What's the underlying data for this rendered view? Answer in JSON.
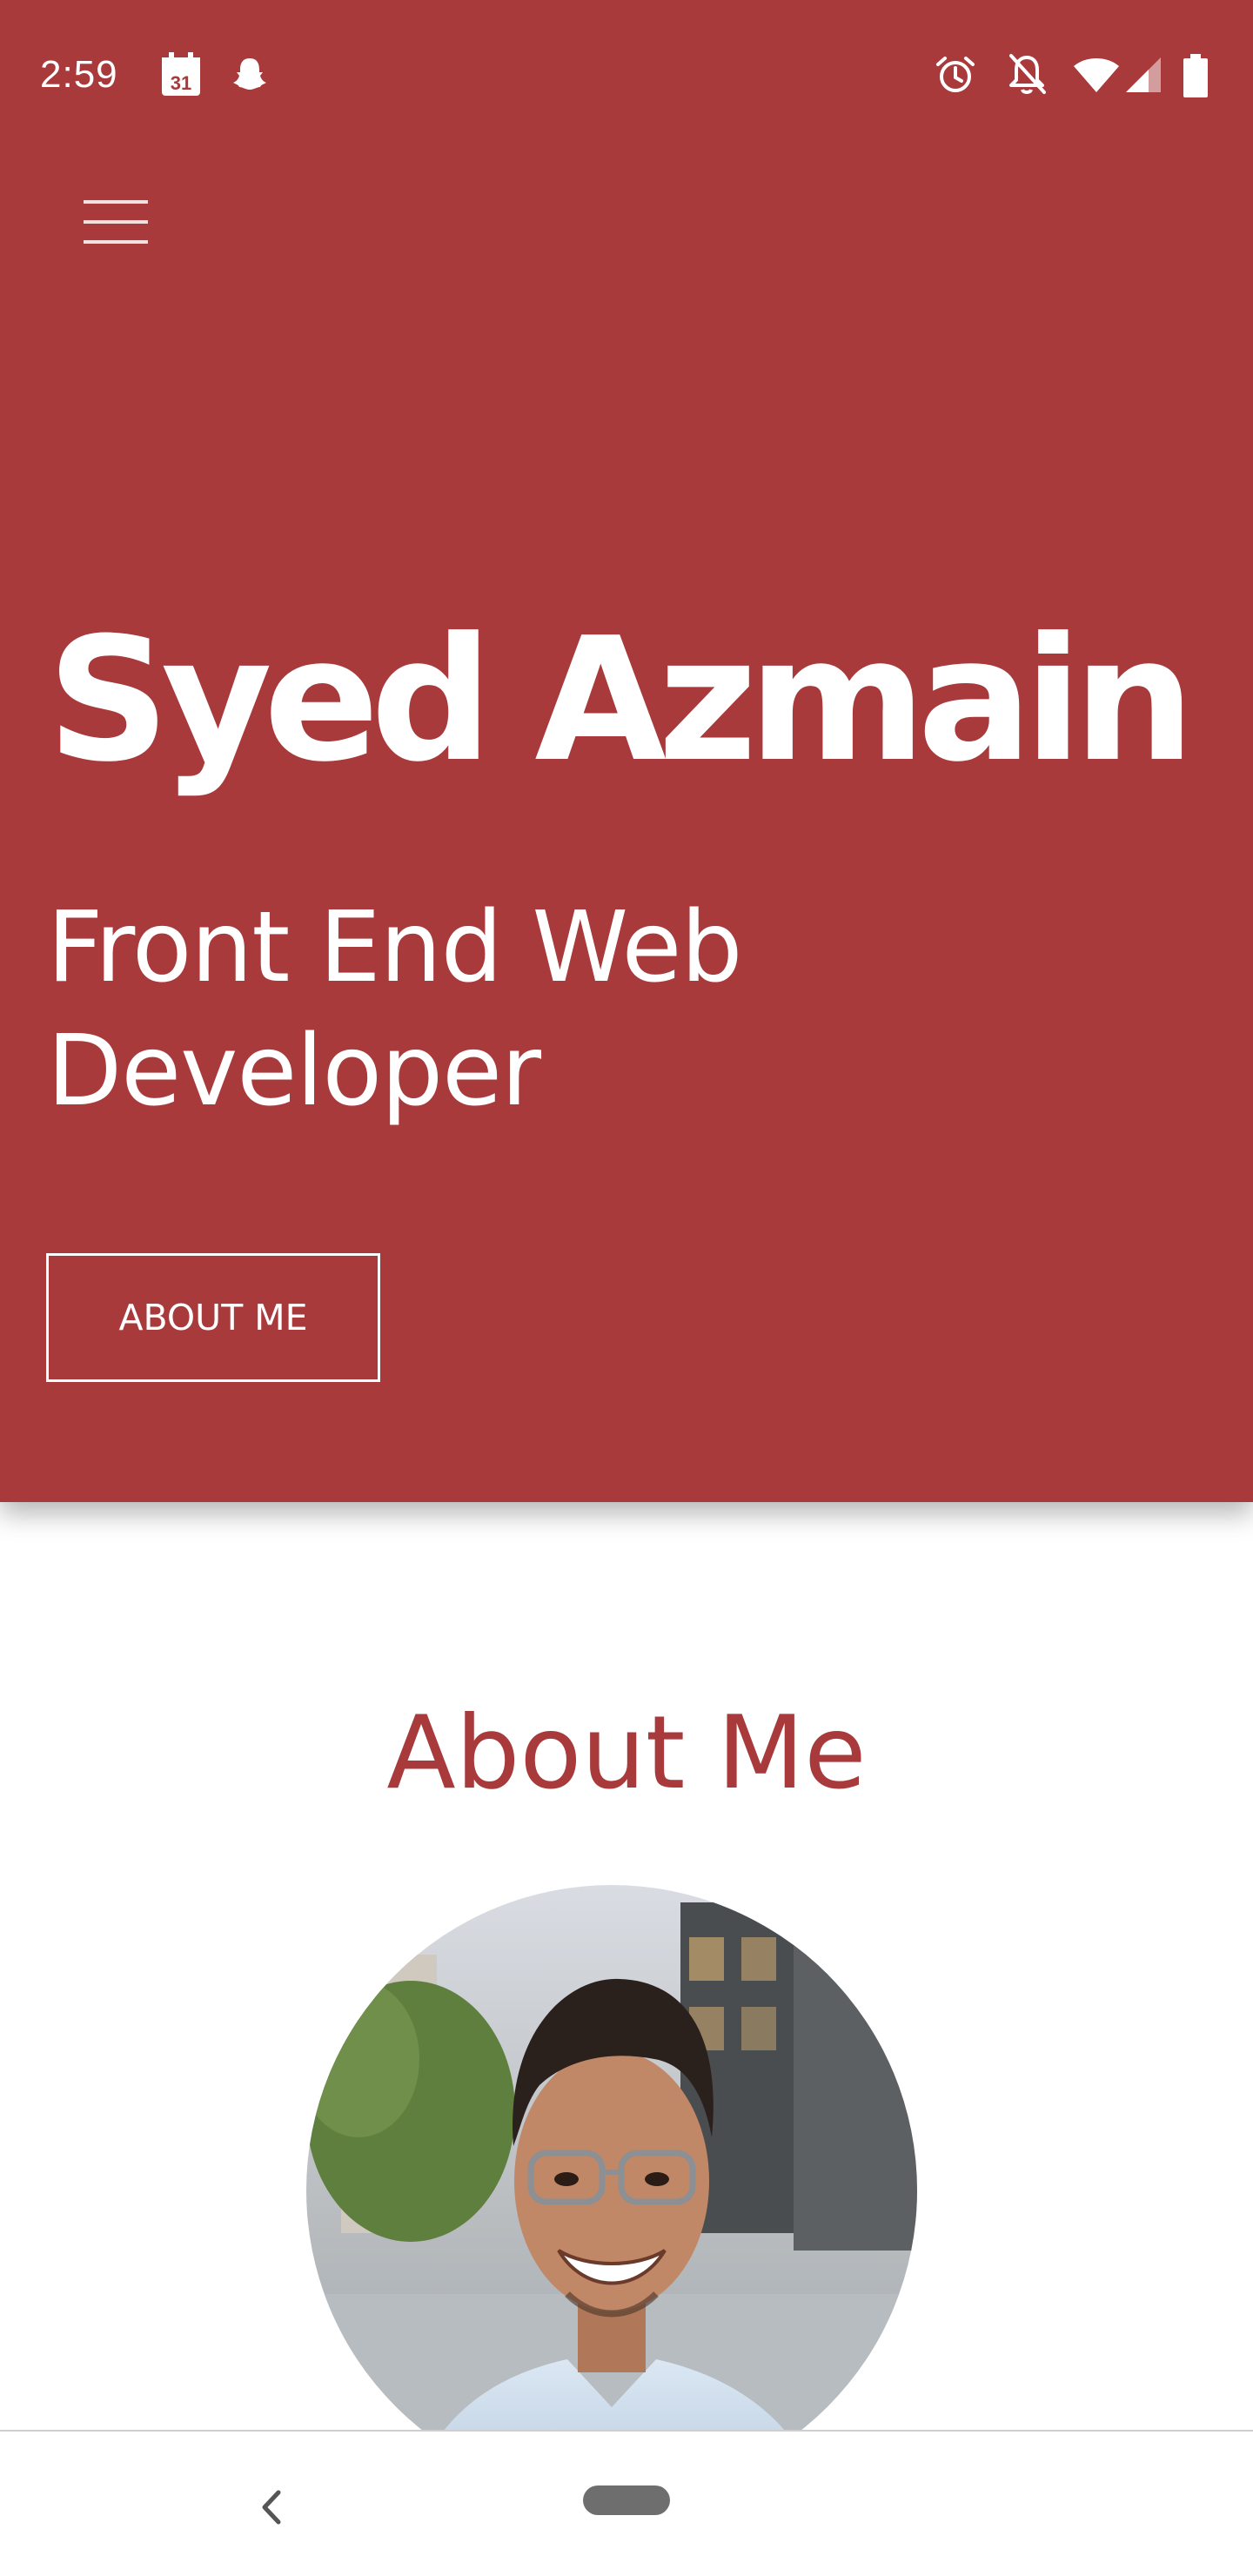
{
  "status_bar": {
    "time": "2:59",
    "calendar_day": "31",
    "left_icons": [
      "calendar-icon",
      "snapchat-ghost-icon"
    ],
    "right_icons": [
      "alarm-icon",
      "notifications-off-icon",
      "wifi-icon",
      "cell-signal-icon",
      "battery-icon"
    ]
  },
  "header": {
    "menu_icon": "hamburger-menu-icon"
  },
  "hero": {
    "name": "Syed Azmain",
    "role": "Front End Web Developer",
    "button_label": "ABOUT ME"
  },
  "about": {
    "title": "About Me",
    "photo": "profile-photo"
  },
  "nav": {
    "back_icon": "back-chevron-icon",
    "home_icon": "home-pill"
  },
  "colors": {
    "brand": "#a83a3b",
    "background": "#ffffff",
    "hero_text": "#ffffff"
  }
}
